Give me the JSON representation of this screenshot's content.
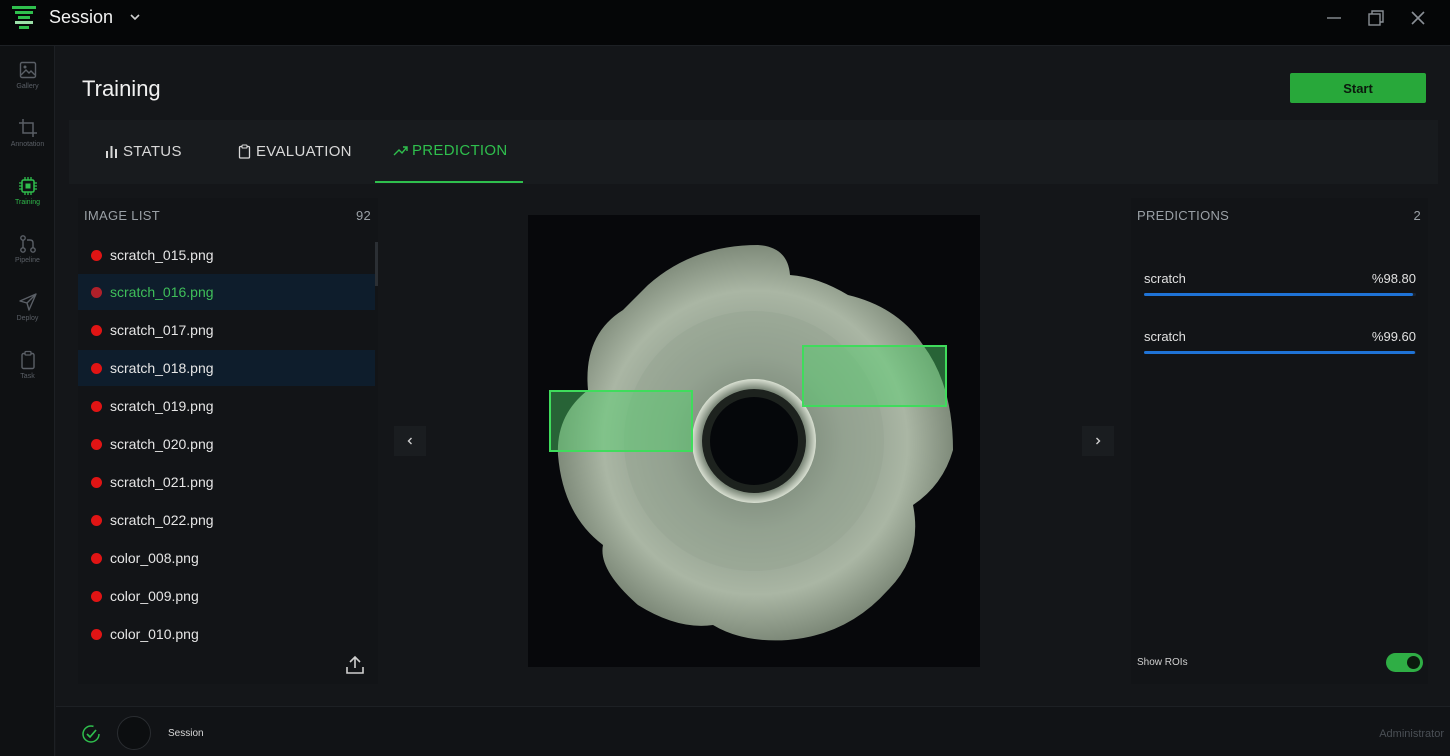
{
  "titlebar": {
    "title": "Session",
    "icons": [
      "app-logo-icon",
      "chevron-down-icon",
      "minimize-icon",
      "restore-icon",
      "close-icon"
    ]
  },
  "sidebar": {
    "items": [
      {
        "label": "Gallery",
        "icon": "image-icon"
      },
      {
        "label": "Annotation",
        "icon": "crop-icon"
      },
      {
        "label": "Training",
        "icon": "chip-icon",
        "active": true
      },
      {
        "label": "Pipeline",
        "icon": "git-branch-icon"
      },
      {
        "label": "Deploy",
        "icon": "send-icon"
      },
      {
        "label": "Task",
        "icon": "clipboard-icon"
      }
    ]
  },
  "header": {
    "title": "Training",
    "start_label": "Start"
  },
  "tabs": [
    {
      "label": "STATUS",
      "icon": "bar-chart-icon"
    },
    {
      "label": "EVALUATION",
      "icon": "clipboard-icon"
    },
    {
      "label": "PREDICTION",
      "icon": "trending-up-icon",
      "active": true
    }
  ],
  "image_list": {
    "title": "IMAGE LIST",
    "count": "92",
    "items": [
      "scratch_015.png",
      "scratch_016.png",
      "scratch_017.png",
      "scratch_018.png",
      "scratch_019.png",
      "scratch_020.png",
      "scratch_021.png",
      "scratch_022.png",
      "color_008.png",
      "color_009.png",
      "color_010.png"
    ]
  },
  "viewer": {
    "prev_icon": "chevron-left-icon",
    "next_icon": "chevron-right-icon"
  },
  "predictions": {
    "title": "PREDICTIONS",
    "count": "2",
    "items": [
      {
        "label": "scratch",
        "score": "%98.80",
        "value": 0.988
      },
      {
        "label": "scratch",
        "score": "%99.60",
        "value": 0.996
      }
    ],
    "show_rois_label": "Show ROIs",
    "show_rois": true
  },
  "bottombar": {
    "session_label": "Session",
    "user": "Administrator"
  },
  "colors": {
    "accent": "#2fbf4d",
    "progress": "#1f73d6",
    "error_dot": "#e01414"
  }
}
